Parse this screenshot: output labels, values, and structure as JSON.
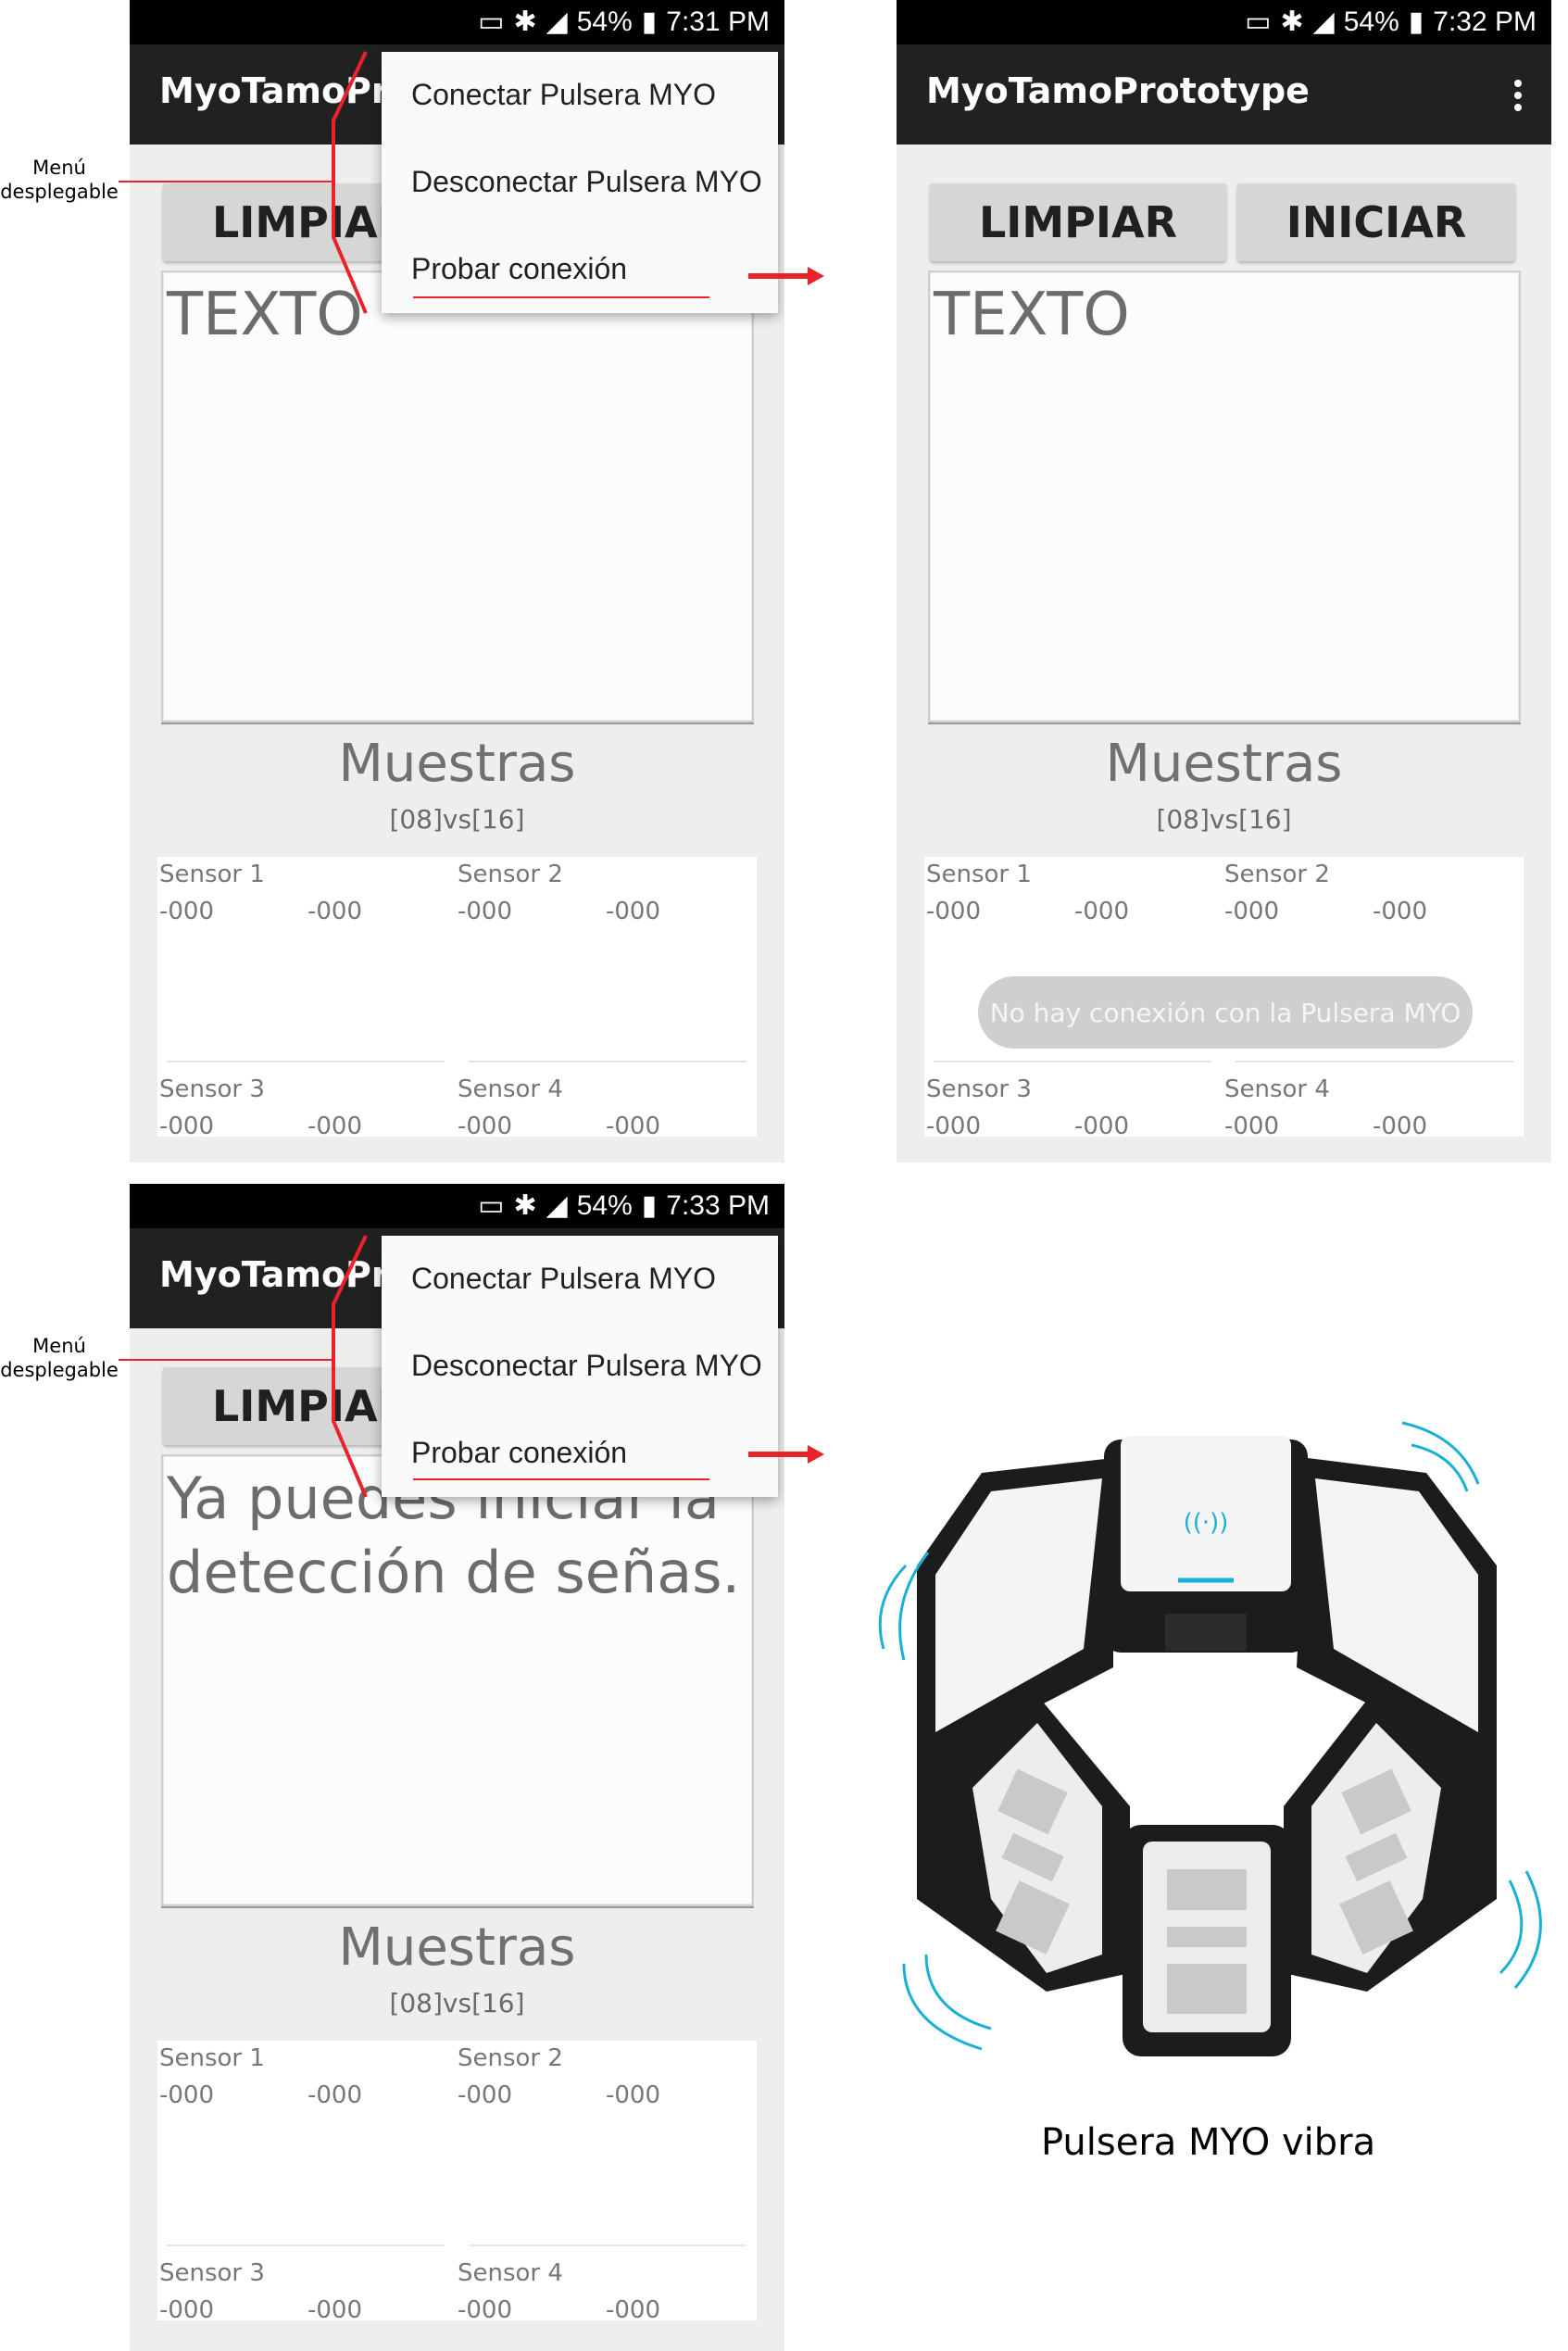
{
  "screens": [
    {
      "status": {
        "battery": "54%",
        "time": "7:31 PM"
      },
      "app_title": "MyoTamoPrototype",
      "clear_button": "LIMPIAR",
      "text_content": "TEXTO",
      "samples_title": "Muestras",
      "samples_ratio": "[08]vs[16]",
      "sensors": [
        {
          "name": "Sensor 1",
          "v1": "-000",
          "v2": "-000"
        },
        {
          "name": "Sensor 2",
          "v1": "-000",
          "v2": "-000"
        },
        {
          "name": "Sensor 3",
          "v1": "-000",
          "v2": "-000"
        },
        {
          "name": "Sensor 4",
          "v1": "-000",
          "v2": "-000"
        }
      ],
      "menu": [
        "Conectar Pulsera MYO",
        "Desconectar Pulsera MYO",
        "Probar conexión"
      ]
    },
    {
      "status": {
        "battery": "54%",
        "time": "7:32 PM"
      },
      "app_title": "MyoTamoPrototype",
      "clear_button": "LIMPIAR",
      "start_button": "INICIAR",
      "text_content": "TEXTO",
      "samples_title": "Muestras",
      "samples_ratio": "[08]vs[16]",
      "sensors": [
        {
          "name": "Sensor 1",
          "v1": "-000",
          "v2": "-000"
        },
        {
          "name": "Sensor 2",
          "v1": "-000",
          "v2": "-000"
        },
        {
          "name": "Sensor 3",
          "v1": "-000",
          "v2": "-000"
        },
        {
          "name": "Sensor 4",
          "v1": "-000",
          "v2": "-000"
        }
      ],
      "toast": "No hay conexión con la Pulsera MYO"
    },
    {
      "status": {
        "battery": "54%",
        "time": "7:33 PM"
      },
      "app_title": "MyoTamoPrototype",
      "clear_button": "LIMPIAR",
      "text_content": "Ya puedes iniciar la detección de señas.",
      "samples_title": "Muestras",
      "samples_ratio": "[08]vs[16]",
      "sensors": [
        {
          "name": "Sensor 1",
          "v1": "-000",
          "v2": "-000"
        },
        {
          "name": "Sensor 2",
          "v1": "-000",
          "v2": "-000"
        },
        {
          "name": "Sensor 3",
          "v1": "-000",
          "v2": "-000"
        },
        {
          "name": "Sensor 4",
          "v1": "-000",
          "v2": "-000"
        }
      ],
      "menu": [
        "Conectar Pulsera MYO",
        "Desconectar Pulsera MYO",
        "Probar conexión"
      ]
    }
  ],
  "annotations": {
    "menu_label_line1": "Menú",
    "menu_label_line2": "desplegable",
    "annotation_color": "#e8232a"
  },
  "myo_caption": "Pulsera MYO vibra",
  "colors": {
    "app_bar": "#212121",
    "status_bar": "#000000",
    "myo_accent": "#1ab0d6"
  }
}
